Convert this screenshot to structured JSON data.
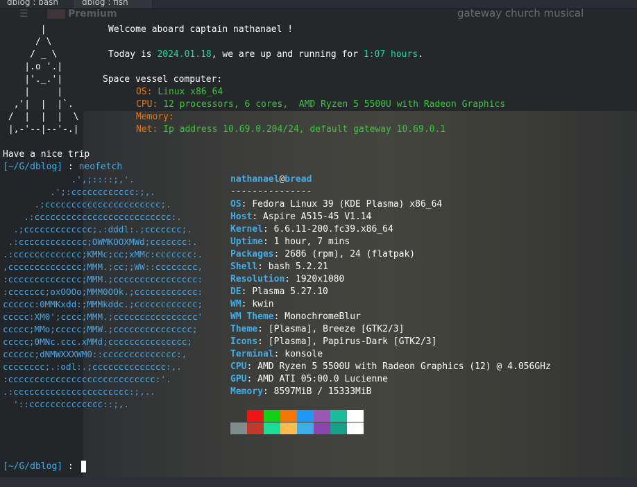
{
  "tabs": [
    {
      "label": "dblog : bash"
    },
    {
      "label": "dblog : fish"
    }
  ],
  "browser_overlay": {
    "brand": "Premium",
    "search_text": "gateway church musical"
  },
  "motd": {
    "ship_art": [
      "       |     ",
      "      / \\    ",
      "     / _ \\   ",
      "    |.o '.|  ",
      "    |'._.'|  ",
      "    |     |  ",
      "  ,'|  |  |`.",
      " /  |  |  |  \\",
      " |,-'--|--'-.|"
    ],
    "welcome": "Welcome aboard captain nathanael !",
    "today_prefix": "Today is ",
    "date": "2024.01.18",
    "today_mid": ", we are up and running for ",
    "uptime": "1:07 hours",
    "today_suffix": ".",
    "vessel_title": "Space vessel computer:",
    "os_key": "OS: ",
    "os_val": "Linux x86_64",
    "cpu_key": "CPU: ",
    "cpu_val": "12 processors, 6 cores,  AMD Ryzen 5 5500U with Radeon Graphics",
    "mem_key": "Memory:",
    "net_key": "Net: ",
    "net_val": "Ip address 10.69.0.204/24, default gateway 10.69.0.1",
    "farewell": "Have a nice trip"
  },
  "prompt1": {
    "path": "[~/G/dblog]",
    "sep": " : ",
    "command": "neofetch"
  },
  "neofetch": {
    "logo": [
      "             .',;::::;,'.",
      "         .';:cccccccccccc:;,.",
      "      .;cccccccccccccccccccccc;.",
      "    .:cccccccccccccccccccccccccc:.",
      "  .;ccccccccccccc;.:dddl:.;ccccccc;.",
      " .:ccccccccccccc;OWMKOOXMWd;ccccccc:.",
      ".:ccccccccccccc;KMMc;cc;xMMc:ccccccc:.",
      ",cccccccccccccc;MMM.;cc;;WW::cccccccc,",
      ":cccccccccccccc;MMM.;cccccccccccccccc:",
      ":ccccccc;oxOOOo;MMM0OOk.;cccccccccccc:",
      "cccccc:0MMKxdd:;MMMkddc.;cccccccccccc;",
      "ccccc:XM0';cccc;MMM.;cccccccccccccccc'",
      "ccccc;MMo;ccccc;MMW.;ccccccccccccccc;",
      "ccccc;0MNc.ccc.xMMd;ccccccccccccccc;",
      "cccccc;dNMWXXXWM0::cccccccccccccc:,",
      "cccccccc;.:odl:.;cccccccccccccc:,.",
      ":cccccccccccccccccccccccccccc:'.",
      ".:cccccccccccccccccccccc:;,..",
      "  '::cccccccccccccc::;,."
    ],
    "user": "nathanael",
    "at": "@",
    "host": "bread",
    "underline": "---------------",
    "fields": [
      {
        "key": "OS",
        "value": "Fedora Linux 39 (KDE Plasma) x86_64"
      },
      {
        "key": "Host",
        "value": "Aspire A515-45 V1.14"
      },
      {
        "key": "Kernel",
        "value": "6.6.11-200.fc39.x86_64"
      },
      {
        "key": "Uptime",
        "value": "1 hour, 7 mins"
      },
      {
        "key": "Packages",
        "value": "2686 (rpm), 24 (flatpak)"
      },
      {
        "key": "Shell",
        "value": "bash 5.2.21"
      },
      {
        "key": "Resolution",
        "value": "1920x1080"
      },
      {
        "key": "DE",
        "value": "Plasma 5.27.10"
      },
      {
        "key": "WM",
        "value": "kwin"
      },
      {
        "key": "WM Theme",
        "value": "MonochromeBlur"
      },
      {
        "key": "Theme",
        "value": "[Plasma], Breeze [GTK2/3]"
      },
      {
        "key": "Icons",
        "value": "[Plasma], Papirus-Dark [GTK2/3]"
      },
      {
        "key": "Terminal",
        "value": "konsole"
      },
      {
        "key": "CPU",
        "value": "AMD Ryzen 5 5500U with Radeon Graphics (12) @ 4.056GHz"
      },
      {
        "key": "GPU",
        "value": "AMD ATI 05:00.0 Lucienne"
      },
      {
        "key": "Memory",
        "value": "8597MiB / 15333MiB"
      }
    ],
    "colors_top": [
      "#ed1515",
      "#11d116",
      "#f67400",
      "#1d99f3",
      "#9b59b6",
      "#1abc9c",
      "#ffffff"
    ],
    "colors_bottom": [
      "#7f8c8d",
      "#c0392b",
      "#1cdc9a",
      "#fdbc4b",
      "#3daee9",
      "#8e44ad",
      "#16a085",
      "#ffffff"
    ]
  },
  "prompt2": {
    "path": "[~/G/dblog]",
    "sep": " : "
  }
}
